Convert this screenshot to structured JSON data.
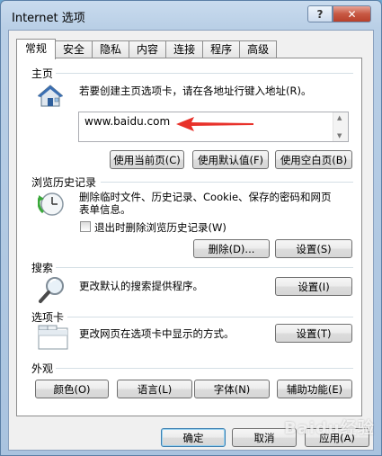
{
  "window": {
    "title": "Internet 选项",
    "help_label": "?",
    "close_label": "✕"
  },
  "tabs": [
    "常规",
    "安全",
    "隐私",
    "内容",
    "连接",
    "程序",
    "高级"
  ],
  "home": {
    "title": "主页",
    "desc": "若要创建主页选项卡，请在各地址行键入地址(R)。",
    "url": "www.baidu.com",
    "buttons": [
      "使用当前页(C)",
      "使用默认值(F)",
      "使用空白页(B)"
    ]
  },
  "history": {
    "title": "浏览历史记录",
    "desc_line1": "删除临时文件、历史记录、Cookie、保存的密码和网页",
    "desc_line2": "表单信息。",
    "checkbox_label": "退出时删除浏览历史记录(W)",
    "delete_label": "删除(D)...",
    "settings_label": "设置(S)"
  },
  "search": {
    "title": "搜索",
    "desc": "更改默认的搜索提供程序。",
    "settings_label": "设置(I)"
  },
  "tabs_section": {
    "title": "选项卡",
    "desc": "更改网页在选项卡中显示的方式。",
    "settings_label": "设置(T)"
  },
  "appearance": {
    "title": "外观",
    "buttons": [
      "颜色(O)",
      "语言(L)",
      "字体(N)",
      "辅助功能(E)"
    ]
  },
  "footer": {
    "ok": "确定",
    "cancel": "取消",
    "apply": "应用(A)"
  },
  "watermark": "Baidu经验",
  "colors": {
    "arrow": "#e8312a",
    "titlebar": "#b9cfe6",
    "close": "#c75843"
  },
  "icons": [
    "house-icon",
    "history-clock-icon",
    "search-magnifier-icon",
    "tabs-window-icon"
  ]
}
